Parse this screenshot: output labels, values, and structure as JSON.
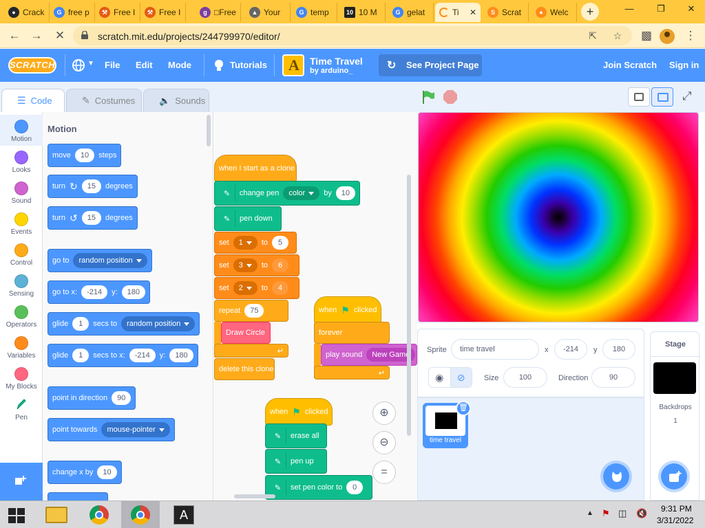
{
  "browser": {
    "tabs": [
      {
        "label": "Crack",
        "fav": "github-icon",
        "color": "#24292e"
      },
      {
        "label": "free p",
        "fav": "google-icon",
        "color": "#4285f4"
      },
      {
        "label": "Free I",
        "fav": "tool-icon",
        "color": "#e55b13"
      },
      {
        "label": "Free I",
        "fav": "tool-icon",
        "color": "#e55b13"
      },
      {
        "label": "□Free",
        "fav": "g-icon",
        "color": "#7b3fa0"
      },
      {
        "label": "Your",
        "fav": "cat-icon",
        "color": "#666666"
      },
      {
        "label": "temp",
        "fav": "google-icon",
        "color": "#4285f4"
      },
      {
        "label": "10 M",
        "fav": "ten-icon",
        "color": "#222222"
      },
      {
        "label": "gelat",
        "fav": "google-icon",
        "color": "#4285f4"
      },
      {
        "label": "Ti",
        "fav": "loading-icon",
        "color": "#ff8c1a"
      },
      {
        "label": "Scrat",
        "fav": "scratch-icon",
        "color": "#ff8c1a"
      },
      {
        "label": "Welc",
        "fav": "scratch-cat-icon",
        "color": "#ff8c1a"
      }
    ],
    "new_tab": "+",
    "url": "scratch.mit.edu/projects/244799970/editor/"
  },
  "menu": {
    "logo": "SCRATCH",
    "file": "File",
    "edit": "Edit",
    "mode": "Mode",
    "tutorials": "Tutorials",
    "project_title": "Time Travel",
    "project_author": "by arduino_",
    "see_project": "See Project Page",
    "join": "Join Scratch",
    "sign_in": "Sign in"
  },
  "editor_tabs": {
    "code": "Code",
    "costumes": "Costumes",
    "sounds": "Sounds"
  },
  "categories": [
    {
      "label": "Motion",
      "color": "#4c97ff"
    },
    {
      "label": "Looks",
      "color": "#9966ff"
    },
    {
      "label": "Sound",
      "color": "#cf63cf"
    },
    {
      "label": "Events",
      "color": "#ffd500"
    },
    {
      "label": "Control",
      "color": "#ffab19"
    },
    {
      "label": "Sensing",
      "color": "#5cb1d6"
    },
    {
      "label": "Operators",
      "color": "#59c059"
    },
    {
      "label": "Variables",
      "color": "#ff8c1a"
    },
    {
      "label": "My Blocks",
      "color": "#ff6680"
    },
    {
      "label": "Pen",
      "color": "#0fbd8c"
    }
  ],
  "palette": {
    "title": "Motion",
    "move": {
      "a": "move",
      "v": "10",
      "b": "steps"
    },
    "turn_cw": {
      "a": "turn",
      "v": "15",
      "b": "degrees"
    },
    "turn_ccw": {
      "a": "turn",
      "v": "15",
      "b": "degrees"
    },
    "goto": {
      "a": "go to",
      "dd": "random position"
    },
    "goto_xy": {
      "a": "go to x:",
      "x": "-214",
      "b": "y:",
      "y": "180"
    },
    "glide": {
      "a": "glide",
      "v": "1",
      "b": "secs to",
      "dd": "random position"
    },
    "glide_xy": {
      "a": "glide",
      "v": "1",
      "b": "secs to x:",
      "x": "-214",
      "c": "y:",
      "y": "180"
    },
    "point_dir": {
      "a": "point in direction",
      "v": "90"
    },
    "point_towards": {
      "a": "point towards",
      "dd": "mouse-pointer"
    },
    "change_x": {
      "a": "change x by",
      "v": "10"
    }
  },
  "scripts": {
    "clone_hat": "when I start as a clone",
    "change_pen": {
      "a": "change pen",
      "dd": "color",
      "b": "by",
      "v": "10"
    },
    "pen_down": "pen down",
    "set1": {
      "a": "set",
      "dd": "1",
      "b": "to",
      "v": "5"
    },
    "set2": {
      "a": "set",
      "dd": "3",
      "b": "to",
      "v": "6"
    },
    "set3": {
      "a": "set",
      "dd": "2",
      "b": "to",
      "v": "4"
    },
    "repeat": {
      "a": "repeat",
      "v": "75"
    },
    "draw_circle": "Draw Circle",
    "delete_clone": "delete this clone",
    "flag_hat_1": {
      "a": "when",
      "b": "clicked"
    },
    "forever": "forever",
    "play_sound": {
      "a": "play sound",
      "dd": "New Game"
    },
    "flag_hat_2": {
      "a": "when",
      "b": "clicked"
    },
    "erase_all": "erase all",
    "pen_up": "pen up",
    "set_pen_color": {
      "a": "set pen color to",
      "v": "0"
    }
  },
  "sprite": {
    "label_sprite": "Sprite",
    "name": "time travel",
    "label_x": "x",
    "x": "-214",
    "label_y": "y",
    "y": "180",
    "label_size": "Size",
    "size": "100",
    "label_direction": "Direction",
    "direction": "90",
    "card_name": "time travel"
  },
  "stage_panel": {
    "title": "Stage",
    "backdrops_label": "Backdrops",
    "backdrops_count": "1"
  },
  "taskbar": {
    "time": "9:31 PM",
    "date": "3/31/2022",
    "a_app": "A"
  }
}
